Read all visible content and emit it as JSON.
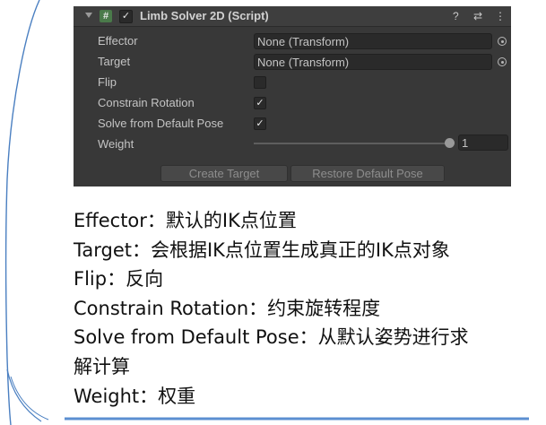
{
  "component": {
    "title": "Limb Solver 2D (Script)",
    "script_icon_glyph": "#",
    "enabled_glyph": "✓",
    "header_icons": {
      "help": "?",
      "presets": "⇄",
      "menu": "⋮"
    }
  },
  "fields": {
    "effector": {
      "label": "Effector",
      "value": "None (Transform)"
    },
    "target": {
      "label": "Target",
      "value": "None (Transform)"
    },
    "flip": {
      "label": "Flip",
      "checked": false
    },
    "constrain_rotation": {
      "label": "Constrain Rotation",
      "checked": true,
      "glyph": "✓"
    },
    "solve_from_default_pose": {
      "label": "Solve from Default Pose",
      "checked": true,
      "glyph": "✓"
    },
    "weight": {
      "label": "Weight",
      "value": "1",
      "slider_fraction": 1.0
    }
  },
  "buttons": {
    "create_target": "Create Target",
    "restore_default_pose": "Restore Default Pose"
  },
  "notes": [
    "Effector：默认的IK点位置",
    "Target：会根据IK点位置生成真正的IK点对象",
    "Flip：反向",
    "Constrain Rotation：约束旋转程度",
    "Solve from Default Pose：从默认姿势进行求",
    "解计算",
    "Weight：权重"
  ],
  "colors": {
    "panel_bg": "#383838",
    "callout_line": "#4a7fc1"
  }
}
